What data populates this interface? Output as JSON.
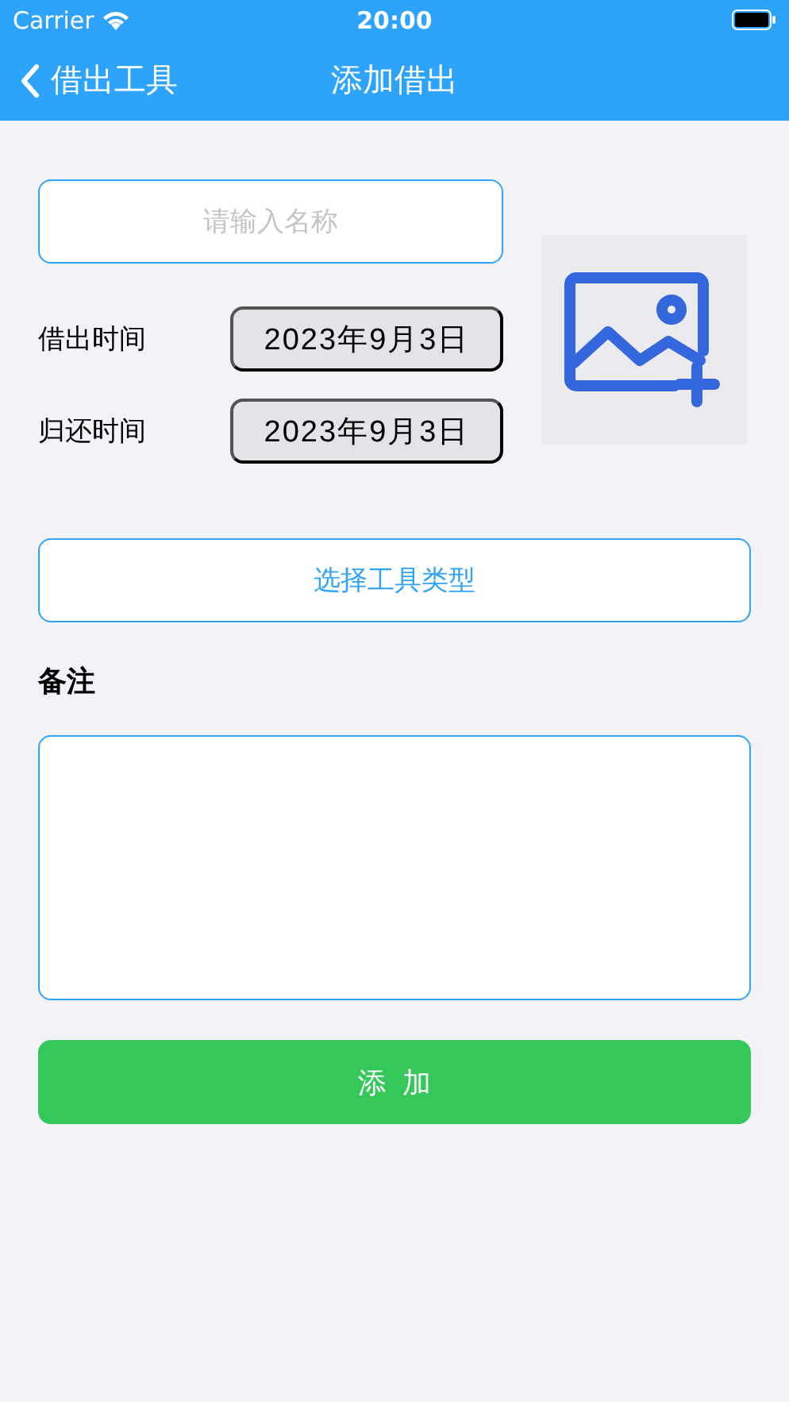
{
  "status_bar": {
    "carrier": "Carrier",
    "time": "20:00"
  },
  "nav": {
    "back_label": "借出工具",
    "title": "添加借出"
  },
  "form": {
    "name_field": {
      "placeholder": "请输入名称"
    },
    "dates": [
      {
        "label": "借出时间",
        "value": "2023年9月3日"
      },
      {
        "label": "归还时间",
        "value": "2023年9月3日"
      }
    ],
    "type_button": "选择工具类型",
    "remark_label": "备注",
    "add_button": "添加"
  }
}
